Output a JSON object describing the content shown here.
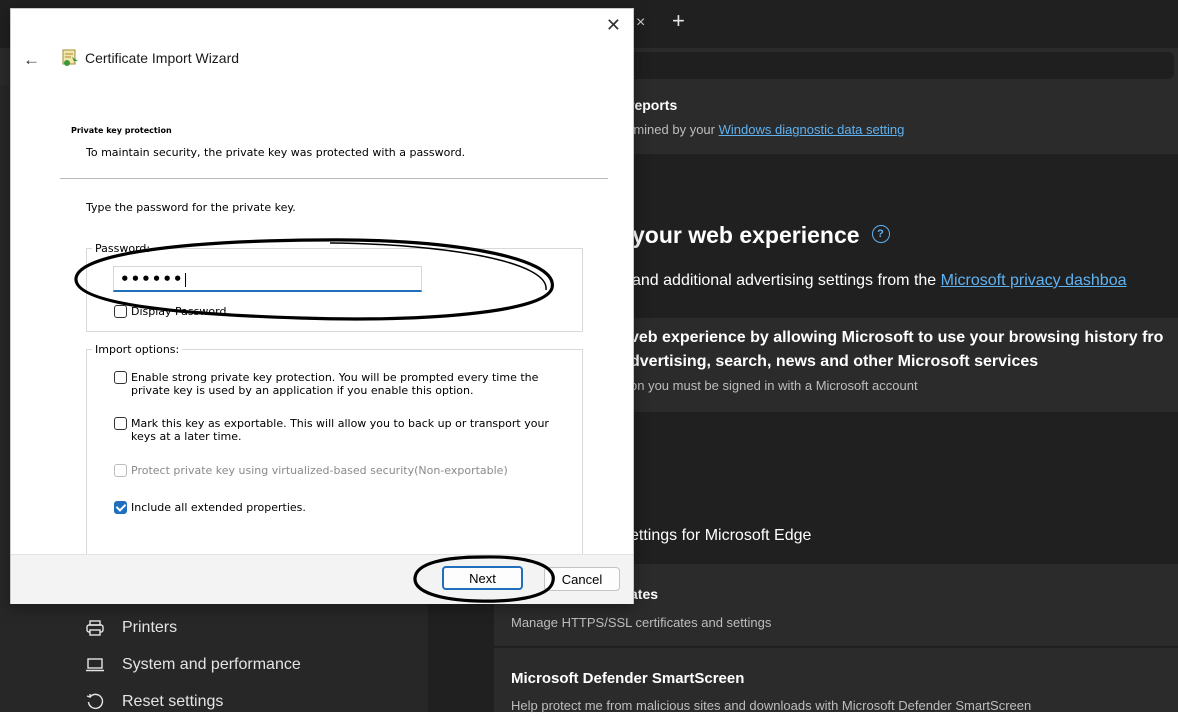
{
  "browser": {
    "tab_close_glyph": "×",
    "new_tab_glyph": "+"
  },
  "sidebar": {
    "items": [
      {
        "label": "Printers",
        "icon": "printer-icon"
      },
      {
        "label": "System and performance",
        "icon": "laptop-icon"
      },
      {
        "label": "Reset settings",
        "icon": "reset-icon"
      }
    ]
  },
  "settings": {
    "reports_title": "reports",
    "reports_desc_prefix": "rmined by your",
    "reports_desc_link": "Windows diagnostic data setting",
    "web_experience_title": "your web experience",
    "web_experience_desc_prefix": "and additional advertising settings from the",
    "web_experience_desc_link": "Microsoft privacy dashboa",
    "personalize_line1": "veb experience by allowing Microsoft to use your browsing history fro",
    "personalize_line2": "dvertising, search, news and other Microsoft services",
    "personalize_note": "on you must be signed in with a Microsoft account",
    "security_heading": "ettings for Microsoft Edge",
    "certificates_title": "ates",
    "certificates_desc": "Manage HTTPS/SSL certificates and settings",
    "smartscreen_title": "Microsoft Defender SmartScreen",
    "smartscreen_desc": "Help protect me from malicious sites and downloads with Microsoft Defender SmartScreen"
  },
  "dialog": {
    "title": "Certificate Import Wizard",
    "close_glyph": "✕",
    "back_glyph": "←",
    "section_title": "Private key protection",
    "section_desc": "To maintain security, the private key was protected with a password.",
    "prompt": "Type the password for the private key.",
    "password_label": "Password:",
    "password_value": "••••••",
    "display_password_label": "Display Password",
    "import_options_label": "Import options:",
    "options": [
      {
        "line1": "Enable strong private key protection. You will be prompted every time the",
        "line2": "private key is used by an application if you enable this option.",
        "checked": false,
        "enabled": true
      },
      {
        "line1": "Mark this key as exportable. This will allow you to back up or transport your",
        "line2": "keys at a later time.",
        "checked": false,
        "enabled": true
      },
      {
        "line1": "Protect private key using virtualized-based security(Non-exportable)",
        "line2": "",
        "checked": false,
        "enabled": false
      },
      {
        "line1": "Include all extended properties.",
        "line2": "",
        "checked": true,
        "enabled": true
      }
    ],
    "next_label": "Next",
    "cancel_label": "Cancel"
  },
  "colors": {
    "accent": "#1f6fbd",
    "link": "#5fb2f2",
    "annotation": "#000000"
  }
}
